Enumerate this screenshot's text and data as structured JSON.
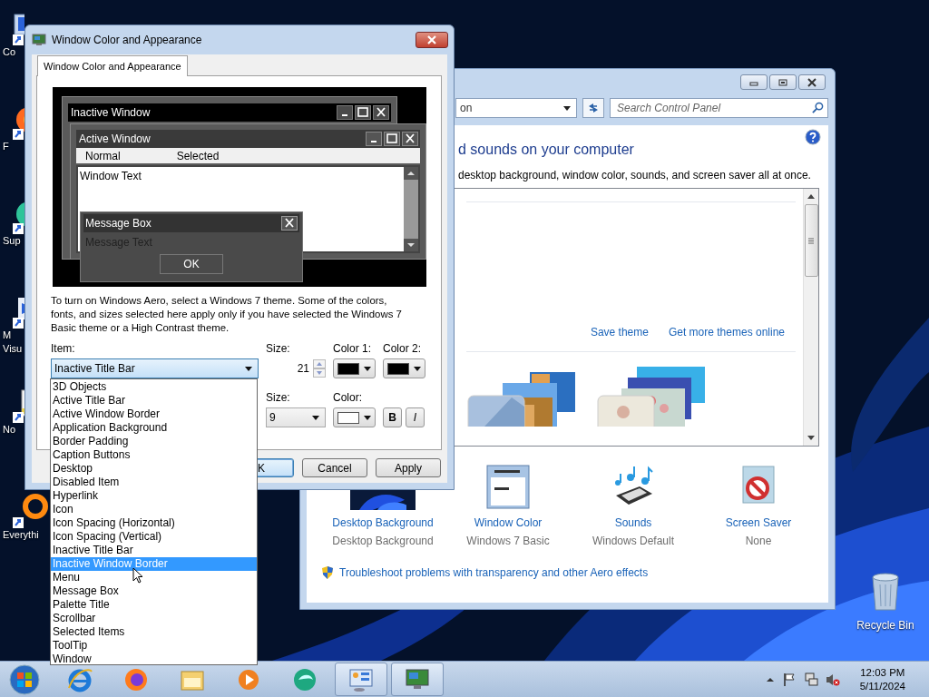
{
  "desktop": {
    "icons": [
      {
        "label": "Co",
        "kind": "computer"
      },
      {
        "label": "F",
        "kind": "firefox"
      },
      {
        "label": "Sup",
        "kind": "app"
      },
      {
        "label": "M",
        "label2": "Visu",
        "kind": "studio"
      },
      {
        "label": "No",
        "kind": "notepad"
      },
      {
        "label": "Everythi",
        "kind": "search"
      }
    ],
    "recycle_bin": {
      "label": "Recycle Bin"
    }
  },
  "control_panel": {
    "address": "on",
    "search": {
      "placeholder": "Search Control Panel"
    },
    "heading": "d sounds on your computer",
    "description": "desktop background, window color, sounds, and screen saver all at once.",
    "links": [
      "Save theme",
      "Get more themes online"
    ],
    "settings": [
      {
        "kind": "background",
        "title": "Desktop Background",
        "value": "Desktop Background"
      },
      {
        "kind": "window",
        "title": "Window Color",
        "value": "Windows 7 Basic"
      },
      {
        "kind": "sounds",
        "title": "Sounds",
        "value": "Windows Default"
      },
      {
        "kind": "saver",
        "title": "Screen Saver",
        "value": "None"
      }
    ],
    "troubleshoot": "Troubleshoot problems with transparency and other Aero effects"
  },
  "dialog": {
    "title": "Window Color and Appearance",
    "tabs": [
      {
        "label": "Window Color and Appearance",
        "selected": true
      }
    ],
    "preview": {
      "inactive_title": "Inactive Window",
      "active_title": "Active Window",
      "menu_normal": "Normal",
      "menu_selected": "Selected",
      "window_text": "Window Text",
      "message_title": "Message Box",
      "message_text": "Message Text",
      "ok": "OK"
    },
    "note": "To turn on Windows Aero, select a Windows 7 theme.  Some of the colors, fonts, and sizes selected here apply only if you have selected the Windows 7 Basic theme or a High Contrast theme.",
    "item": {
      "label": "Item:",
      "value": "Inactive Title Bar"
    },
    "size": {
      "label": "Size:",
      "value": "21"
    },
    "color1": {
      "label": "Color 1:",
      "color": "#000000"
    },
    "color2": {
      "label": "Color 2:",
      "color": "#000000"
    },
    "font_size": {
      "label": "Size:",
      "value": "9"
    },
    "font_color": {
      "label": "Color:",
      "color": "#ffffff"
    },
    "bold": "B",
    "italic": "I",
    "buttons": [
      {
        "label": "K",
        "default": true
      },
      {
        "label": "Cancel",
        "default": false
      },
      {
        "label": "Apply",
        "default": false
      }
    ],
    "dropdown": [
      {
        "label": "3D Objects",
        "selected": false
      },
      {
        "label": "Active Title Bar",
        "selected": false
      },
      {
        "label": "Active Window Border",
        "selected": false
      },
      {
        "label": "Application Background",
        "selected": false
      },
      {
        "label": "Border Padding",
        "selected": false
      },
      {
        "label": "Caption Buttons",
        "selected": false
      },
      {
        "label": "Desktop",
        "selected": false
      },
      {
        "label": "Disabled Item",
        "selected": false
      },
      {
        "label": "Hyperlink",
        "selected": false
      },
      {
        "label": "Icon",
        "selected": false
      },
      {
        "label": "Icon Spacing (Horizontal)",
        "selected": false
      },
      {
        "label": "Icon Spacing (Vertical)",
        "selected": false
      },
      {
        "label": "Inactive Title Bar",
        "selected": false
      },
      {
        "label": "Inactive Window Border",
        "selected": true
      },
      {
        "label": "Menu",
        "selected": false
      },
      {
        "label": "Message Box",
        "selected": false
      },
      {
        "label": "Palette Title",
        "selected": false
      },
      {
        "label": "Scrollbar",
        "selected": false
      },
      {
        "label": "Selected Items",
        "selected": false
      },
      {
        "label": "ToolTip",
        "selected": false
      },
      {
        "label": "Window",
        "selected": false
      }
    ]
  },
  "taskbar": {
    "apps": [
      {
        "kind": "ie",
        "active": false
      },
      {
        "kind": "firefox",
        "active": false
      },
      {
        "kind": "explorer",
        "active": false
      },
      {
        "kind": "media",
        "active": false
      },
      {
        "kind": "green",
        "active": false
      },
      {
        "kind": "control",
        "active": true
      },
      {
        "kind": "display",
        "active": true
      }
    ],
    "time": "12:03 PM",
    "date": "5/11/2024"
  }
}
